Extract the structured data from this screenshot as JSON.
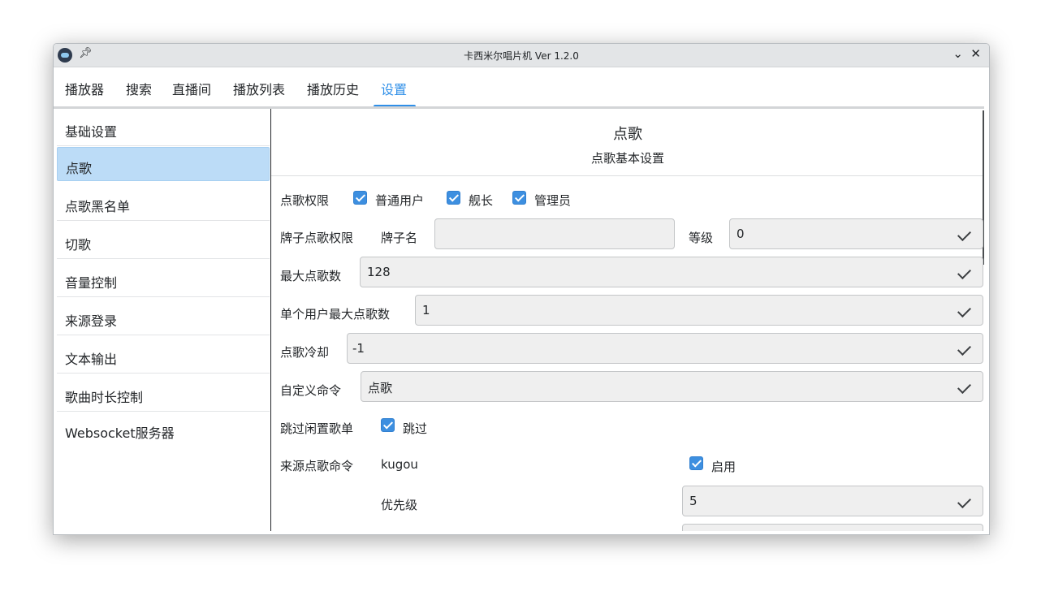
{
  "window": {
    "title": "卡西米尔唱片机 Ver 1.2.0"
  },
  "tabs": [
    {
      "label": "播放器"
    },
    {
      "label": "搜索"
    },
    {
      "label": "直播间"
    },
    {
      "label": "播放列表"
    },
    {
      "label": "播放历史"
    },
    {
      "label": "设置"
    }
  ],
  "active_tab": "设置",
  "sidebar": {
    "items": [
      {
        "label": "基础设置"
      },
      {
        "label": "点歌"
      },
      {
        "label": "点歌黑名单"
      },
      {
        "label": "切歌"
      },
      {
        "label": "音量控制"
      },
      {
        "label": "来源登录"
      },
      {
        "label": "文本输出"
      },
      {
        "label": "歌曲时长控制"
      },
      {
        "label": "Websocket服务器"
      }
    ],
    "selected": "点歌"
  },
  "panel": {
    "title": "点歌",
    "subtitle": "点歌基本设置",
    "permission": {
      "label": "点歌权限",
      "options": [
        {
          "label": "普通用户",
          "checked": true
        },
        {
          "label": "舰长",
          "checked": true
        },
        {
          "label": "管理员",
          "checked": true
        }
      ]
    },
    "medal": {
      "label": "牌子点歌权限",
      "name_label": "牌子名",
      "name_value": "",
      "level_label": "等级",
      "level_value": "0"
    },
    "max_requests": {
      "label": "最大点歌数",
      "value": "128"
    },
    "max_user_requests": {
      "label": "单个用户最大点歌数",
      "value": "1"
    },
    "cooldown": {
      "label": "点歌冷却",
      "value": "-1"
    },
    "custom_command": {
      "label": "自定义命令",
      "value": "点歌"
    },
    "skip_idle": {
      "label": "跳过闲置歌单",
      "option": "跳过",
      "checked": true
    },
    "source_command": {
      "label": "来源点歌命令",
      "source": "kugou",
      "enable_label": "启用",
      "enabled": true,
      "priority_label": "优先级",
      "priority_value": "5"
    }
  },
  "colors": {
    "accent": "#2f8fe8",
    "selected_bg": "#bcdcf7",
    "checkbox": "#3d8fe0"
  }
}
